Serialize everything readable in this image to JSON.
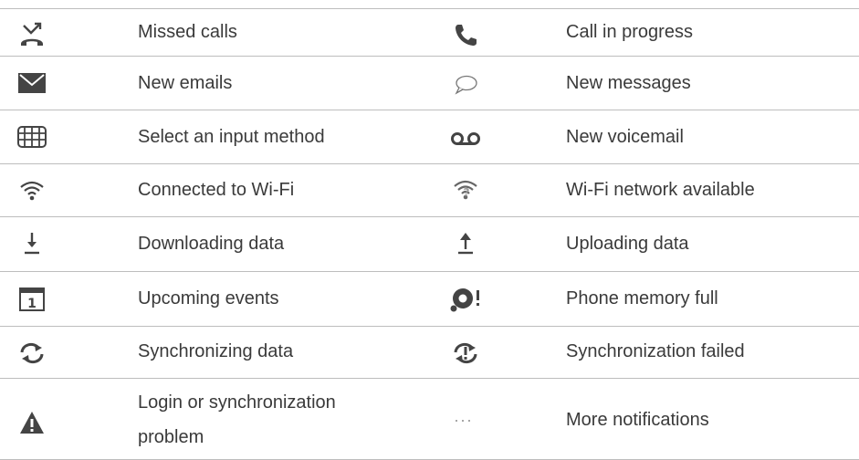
{
  "rows": [
    {
      "left": {
        "icon": "missed-call-icon",
        "label": "Missed calls"
      },
      "right": {
        "icon": "phone-icon",
        "label": "Call in progress"
      }
    },
    {
      "left": {
        "icon": "envelope-icon",
        "label": "New emails"
      },
      "right": {
        "icon": "speech-bubble-icon",
        "label": "New messages"
      }
    },
    {
      "left": {
        "icon": "keyboard-icon",
        "label": "Select an input method"
      },
      "right": {
        "icon": "voicemail-icon",
        "label": "New voicemail"
      }
    },
    {
      "left": {
        "icon": "wifi-icon",
        "label": "Connected to Wi-Fi"
      },
      "right": {
        "icon": "wifi-available-icon",
        "label": "Wi-Fi network available"
      }
    },
    {
      "left": {
        "icon": "download-icon",
        "label": "Downloading data"
      },
      "right": {
        "icon": "upload-icon",
        "label": "Uploading data"
      }
    },
    {
      "left": {
        "icon": "calendar-icon",
        "label": "Upcoming events",
        "icon_text": "1"
      },
      "right": {
        "icon": "memory-full-icon",
        "label": "Phone memory full"
      }
    },
    {
      "left": {
        "icon": "sync-icon",
        "label": "Synchronizing data"
      },
      "right": {
        "icon": "sync-failed-icon",
        "label": "Synchronization failed"
      }
    },
    {
      "left": {
        "icon": "warning-icon",
        "label": "Login or synchronization problem",
        "label_line1": "Login or synchronization",
        "label_line2": "problem"
      },
      "right": {
        "icon": "more-icon",
        "label": "More notifications",
        "icon_text": "···"
      }
    }
  ],
  "colors": {
    "icon": "#444444",
    "rule": "#bdbdbd",
    "text": "#3a3a3a"
  }
}
